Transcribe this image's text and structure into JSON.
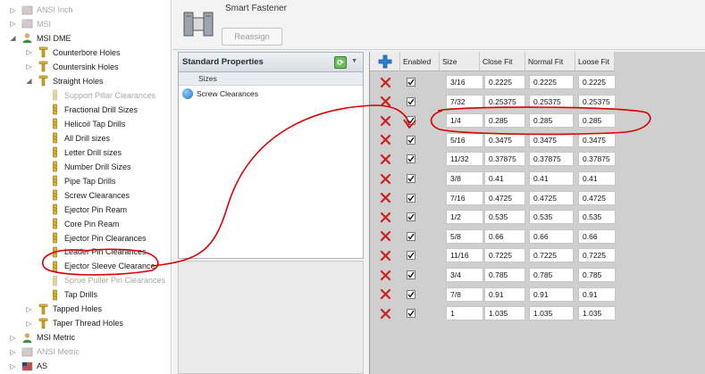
{
  "tree": {
    "items": [
      {
        "label": "ANSI Inch",
        "level": 0,
        "expander": "▷",
        "icon": "flag",
        "muted": true
      },
      {
        "label": "MSI",
        "level": 0,
        "expander": "▷",
        "icon": "flag",
        "muted": true
      },
      {
        "label": "MSI DME",
        "level": 0,
        "expander": "◢",
        "icon": "person",
        "muted": false
      },
      {
        "label": "Counterbore Holes",
        "level": 1,
        "expander": "▷",
        "icon": "tool",
        "muted": false
      },
      {
        "label": "Countersink Holes",
        "level": 1,
        "expander": "▷",
        "icon": "tool",
        "muted": false
      },
      {
        "label": "Straight Holes",
        "level": 1,
        "expander": "◢",
        "icon": "tool",
        "muted": false
      },
      {
        "label": "Support Pillar Clearances",
        "level": 2,
        "expander": "",
        "icon": "bit",
        "muted": true
      },
      {
        "label": "Fractional Drill Sizes",
        "level": 2,
        "expander": "",
        "icon": "bit",
        "muted": false
      },
      {
        "label": "Helicoil Tap Drills",
        "level": 2,
        "expander": "",
        "icon": "bit",
        "muted": false
      },
      {
        "label": "All Drill sizes",
        "level": 2,
        "expander": "",
        "icon": "bit",
        "muted": false
      },
      {
        "label": "Letter Drill sizes",
        "level": 2,
        "expander": "",
        "icon": "bit",
        "muted": false
      },
      {
        "label": "Number Drill Sizes",
        "level": 2,
        "expander": "",
        "icon": "bit",
        "muted": false
      },
      {
        "label": "Pipe Tap Drills",
        "level": 2,
        "expander": "",
        "icon": "bit",
        "muted": false
      },
      {
        "label": "Screw Clearances",
        "level": 2,
        "expander": "",
        "icon": "bit",
        "muted": false
      },
      {
        "label": "Ejector Pin Ream",
        "level": 2,
        "expander": "",
        "icon": "bit",
        "muted": false
      },
      {
        "label": "Core Pin Ream",
        "level": 2,
        "expander": "",
        "icon": "bit",
        "muted": false
      },
      {
        "label": "Ejector Pin Clearances",
        "level": 2,
        "expander": "",
        "icon": "bit",
        "muted": false
      },
      {
        "label": "Leader Pin Clearances",
        "level": 2,
        "expander": "",
        "icon": "bit",
        "muted": false
      },
      {
        "label": "Ejector Sleeve Clearance",
        "level": 2,
        "expander": "",
        "icon": "bit",
        "muted": false
      },
      {
        "label": "Sprue Puller Pin Clearances",
        "level": 2,
        "expander": "",
        "icon": "bit",
        "muted": true
      },
      {
        "label": "Tap Drills",
        "level": 2,
        "expander": "",
        "icon": "bit",
        "muted": false
      },
      {
        "label": "Tapped Holes",
        "level": 1,
        "expander": "▷",
        "icon": "tool",
        "muted": false
      },
      {
        "label": "Taper Thread Holes",
        "level": 1,
        "expander": "▷",
        "icon": "tool",
        "muted": false
      },
      {
        "label": "MSI Metric",
        "level": 0,
        "expander": "▷",
        "icon": "person",
        "muted": false
      },
      {
        "label": "ANSI Metric",
        "level": 0,
        "expander": "▷",
        "icon": "flag",
        "muted": true
      },
      {
        "label": "AS",
        "level": 0,
        "expander": "▷",
        "icon": "flag",
        "muted": false
      }
    ]
  },
  "header": {
    "title": "Smart Fastener",
    "reassign_label": "Reassign"
  },
  "properties": {
    "title": "Standard Properties",
    "group_label": "Sizes",
    "item_label": "Screw Clearances"
  },
  "grid": {
    "columns": [
      "Enabled",
      "Size",
      "Close Fit",
      "Normal Fit",
      "Loose Fit"
    ],
    "rows": [
      [
        "3/16",
        "0.2225",
        "0.2225",
        "0.2225"
      ],
      [
        "7/32",
        "0.25375",
        "0.25375",
        "0.25375"
      ],
      [
        "1/4",
        "0.285",
        "0.285",
        "0.285"
      ],
      [
        "5/16",
        "0.3475",
        "0.3475",
        "0.3475"
      ],
      [
        "11/32",
        "0.37875",
        "0.37875",
        "0.37875"
      ],
      [
        "3/8",
        "0.41",
        "0.41",
        "0.41"
      ],
      [
        "7/16",
        "0.4725",
        "0.4725",
        "0.4725"
      ],
      [
        "1/2",
        "0.535",
        "0.535",
        "0.535"
      ],
      [
        "5/8",
        "0.66",
        "0.66",
        "0.66"
      ],
      [
        "11/16",
        "0.7225",
        "0.7225",
        "0.7225"
      ],
      [
        "3/4",
        "0.785",
        "0.785",
        "0.785"
      ],
      [
        "7/8",
        "0.91",
        "0.91",
        "0.91"
      ],
      [
        "1",
        "1.035",
        "1.035",
        "1.035"
      ]
    ]
  },
  "colors": {
    "delete_red": "#cc1f1f",
    "annotation_red": "#d90000",
    "add_blue": "#2b7fd0"
  }
}
